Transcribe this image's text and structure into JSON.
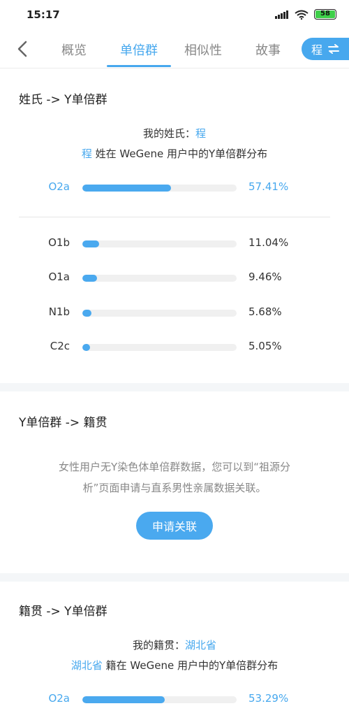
{
  "status": {
    "time": "15:17",
    "battery": "58"
  },
  "nav": {
    "tabs": [
      "概览",
      "单倍群",
      "相似性",
      "故事"
    ],
    "active_tab": 1,
    "surname_button": "程"
  },
  "section1": {
    "title": "姓氏 -> Y单倍群",
    "my_label": "我的姓氏：",
    "my_value": "程",
    "dist_prefix": "程",
    "dist_suffix": " 姓在 WeGene 用户中的Y单倍群分布",
    "top": {
      "label": "O2a",
      "value": "57.41%",
      "fraction": 0.5741
    },
    "rows": [
      {
        "label": "O1b",
        "value": "11.04%",
        "fraction": 0.1104
      },
      {
        "label": "O1a",
        "value": "9.46%",
        "fraction": 0.0946
      },
      {
        "label": "N1b",
        "value": "5.68%",
        "fraction": 0.0568
      },
      {
        "label": "C2c",
        "value": "5.05%",
        "fraction": 0.0505
      }
    ]
  },
  "section2": {
    "title": "Y单倍群 -> 籍贯",
    "notice_line1": "女性用户无Y染色体单倍群数据，您可以到“祖源分",
    "notice_line2": "析”页面申请与直系男性亲属数据关联。",
    "button": "申请关联"
  },
  "section3": {
    "title": "籍贯 -> Y单倍群",
    "my_label": "我的籍贯：",
    "my_value": "湖北省",
    "dist_prefix": "湖北省",
    "dist_suffix": " 籍在 WeGene 用户中的Y单倍群分布",
    "top": {
      "label": "O2a",
      "value": "53.29%",
      "fraction": 0.5329
    }
  },
  "colors": {
    "accent": "#47a8ee",
    "bar": "#4aa9ef",
    "track": "#f0f0f0"
  }
}
